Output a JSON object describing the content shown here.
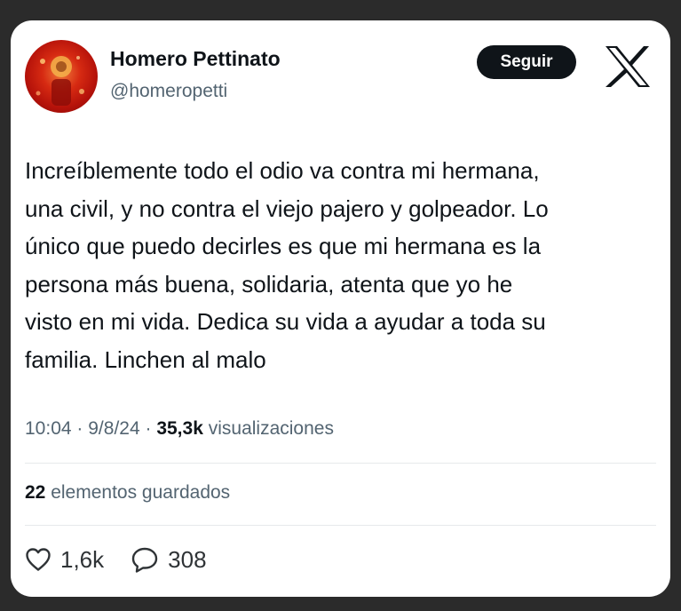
{
  "author": {
    "display_name": "Homero Pettinato",
    "handle": "@homeropetti",
    "avatar_icon": "profile-photo-avatar"
  },
  "follow_button": {
    "label": "Seguir"
  },
  "brand": {
    "logo": "x-logo-icon"
  },
  "tweet": {
    "text": "Increíblemente todo el odio va contra mi hermana,\nuna civil, y no contra el viejo pajero y golpeador. Lo\núnico que puedo decirles es que mi hermana es la\npersona más buena, solidaria, atenta que yo he\nvisto en mi vida. Dedica su vida a ayudar a toda su\nfamilia. Linchen al malo"
  },
  "meta": {
    "time": "10:04",
    "separator": "·",
    "date": "9/8/24",
    "views_count": "35,3k",
    "views_label": "visualizaciones"
  },
  "bookmarks": {
    "count": "22",
    "label": "elementos guardados"
  },
  "actions": {
    "likes": "1,6k",
    "replies": "308"
  },
  "colors": {
    "page_background": "#2b2b2b",
    "card_background": "#ffffff",
    "primary_text": "#0f1419",
    "secondary_text": "#536471",
    "button_background": "#0f1419",
    "button_text": "#ffffff",
    "divider": "#e6e9eb"
  }
}
